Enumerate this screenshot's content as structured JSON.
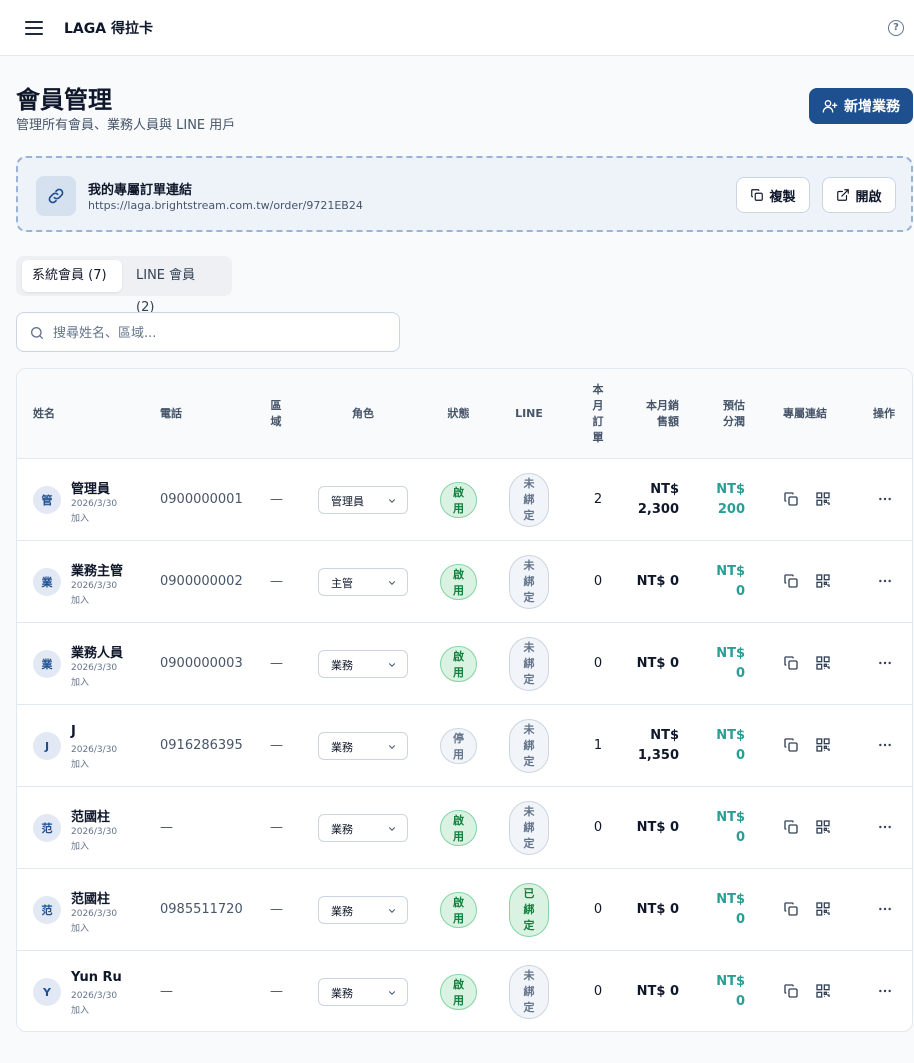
{
  "app": {
    "title": "LAGA 得拉卡",
    "help_icon": "?"
  },
  "page": {
    "title": "會員管理",
    "subtitle": "管理所有會員、業務人員與 LINE 用戶",
    "add_button_label": "新增業務"
  },
  "link_card": {
    "title": "我的專屬訂單連結",
    "url": "https://laga.brightstream.com.tw/order/9721EB24",
    "copy_label": "複製",
    "open_label": "開啟"
  },
  "tabs": [
    {
      "label": "系統會員 (7)",
      "active": true
    },
    {
      "label": "LINE 會員 (2)",
      "active": false
    }
  ],
  "search": {
    "placeholder": "搜尋姓名、區域..."
  },
  "table": {
    "headers": {
      "name": "姓名",
      "phone": "電話",
      "region": "區\n域",
      "role": "角色",
      "status": "狀態",
      "line": "LINE",
      "orders": "本\n月\n訂\n單",
      "sales": "本月銷\n售額",
      "profit": "預估\n分潤",
      "link": "專屬連結",
      "actions": "操作"
    },
    "rows": [
      {
        "avatar": "管",
        "name": "管理員",
        "joined": "2026/3/30\n加入",
        "phone": "0900000001",
        "region": "—",
        "role": "管理員",
        "status": "啟\n用",
        "status_on": true,
        "line": "未\n綁\n定",
        "line_bound": false,
        "orders": "2",
        "sales": "NT$\n2,300",
        "profit": "NT$\n200"
      },
      {
        "avatar": "業",
        "name": "業務主管",
        "joined": "2026/3/30\n加入",
        "phone": "0900000002",
        "region": "—",
        "role": "主管",
        "status": "啟\n用",
        "status_on": true,
        "line": "未\n綁\n定",
        "line_bound": false,
        "orders": "0",
        "sales": "NT$ 0",
        "profit": "NT$\n0"
      },
      {
        "avatar": "業",
        "name": "業務人員",
        "joined": "2026/3/30\n加入",
        "phone": "0900000003",
        "region": "—",
        "role": "業務",
        "status": "啟\n用",
        "status_on": true,
        "line": "未\n綁\n定",
        "line_bound": false,
        "orders": "0",
        "sales": "NT$ 0",
        "profit": "NT$\n0"
      },
      {
        "avatar": "J",
        "name": "J",
        "joined": "2026/3/30\n加入",
        "phone": "0916286395",
        "region": "—",
        "role": "業務",
        "status": "停\n用",
        "status_on": false,
        "line": "未\n綁\n定",
        "line_bound": false,
        "orders": "1",
        "sales": "NT$\n1,350",
        "profit": "NT$\n0"
      },
      {
        "avatar": "范",
        "name": "范國柱",
        "joined": "2026/3/30\n加入",
        "phone": "—",
        "region": "—",
        "role": "業務",
        "status": "啟\n用",
        "status_on": true,
        "line": "未\n綁\n定",
        "line_bound": false,
        "orders": "0",
        "sales": "NT$ 0",
        "profit": "NT$\n0"
      },
      {
        "avatar": "范",
        "name": "范國柱",
        "joined": "2026/3/30\n加入",
        "phone": "0985511720",
        "region": "—",
        "role": "業務",
        "status": "啟\n用",
        "status_on": true,
        "line": "已\n綁\n定",
        "line_bound": true,
        "orders": "0",
        "sales": "NT$ 0",
        "profit": "NT$\n0"
      },
      {
        "avatar": "Y",
        "name": "Yun Ru",
        "joined": "2026/3/30\n加入",
        "phone": "—",
        "region": "—",
        "role": "業務",
        "status": "啟\n用",
        "status_on": true,
        "line": "未\n綁\n定",
        "line_bound": false,
        "orders": "0",
        "sales": "NT$ 0",
        "profit": "NT$\n0"
      }
    ]
  },
  "colors": {
    "primary": "#1e4f8f",
    "profit": "#2a9d95",
    "status_on_bg": "#d9f2e2",
    "status_on_text": "#15803d",
    "status_off_bg": "#f1f5f9"
  }
}
